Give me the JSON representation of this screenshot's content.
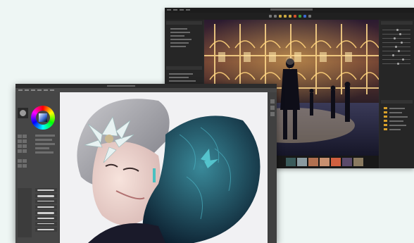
{
  "photo_editor": {
    "window_title": "",
    "accent_color": "#d8a02a"
  },
  "paint_app": {
    "window_title": "",
    "color_wheel": "hsv-color-wheel"
  }
}
